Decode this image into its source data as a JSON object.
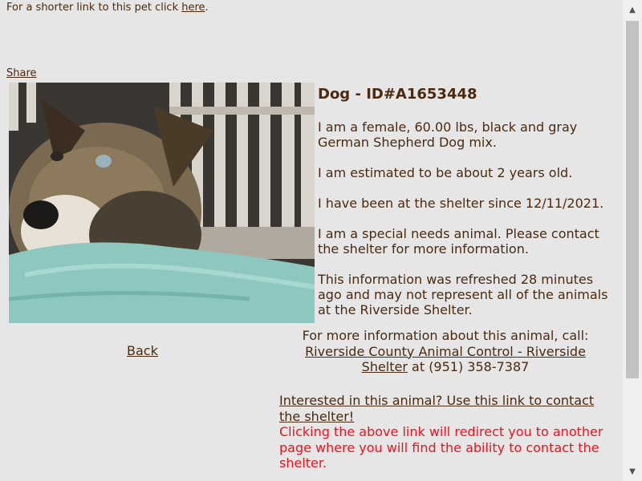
{
  "header": {
    "shorter_link_prefix": "For a shorter link to this pet click ",
    "shorter_link_label": "here",
    "shorter_link_suffix": ".",
    "share_label": "Share"
  },
  "pet": {
    "title": "Dog - ID#A1653448",
    "description": "I am a female, 60.00 lbs, black and gray German Shepherd Dog mix.",
    "age": "I am estimated to be about 2 years old.",
    "since": "I have been at the shelter since 12/11/2021.",
    "special_needs": "I am a special needs animal. Please contact the shelter for more information.",
    "refresh_note": "This information was refreshed 28 minutes ago and may not represent all of the animals at the Riverside Shelter."
  },
  "navigation": {
    "back_label": "Back"
  },
  "contact": {
    "intro": "For more information about this animal, call:",
    "shelter_link": "Riverside County Animal Control - Riverside Shelter",
    "phone_text": " at (951) 358-7387"
  },
  "interest": {
    "link_label": "Interested in this animal? Use this link to contact the shelter!",
    "redirect_note": "Clicking the above link will redirect you to another page where you will find the ability to contact the shelter."
  },
  "colors": {
    "background": "#e6e6e6",
    "text": "#4a2a10",
    "warning": "#e8141e"
  }
}
